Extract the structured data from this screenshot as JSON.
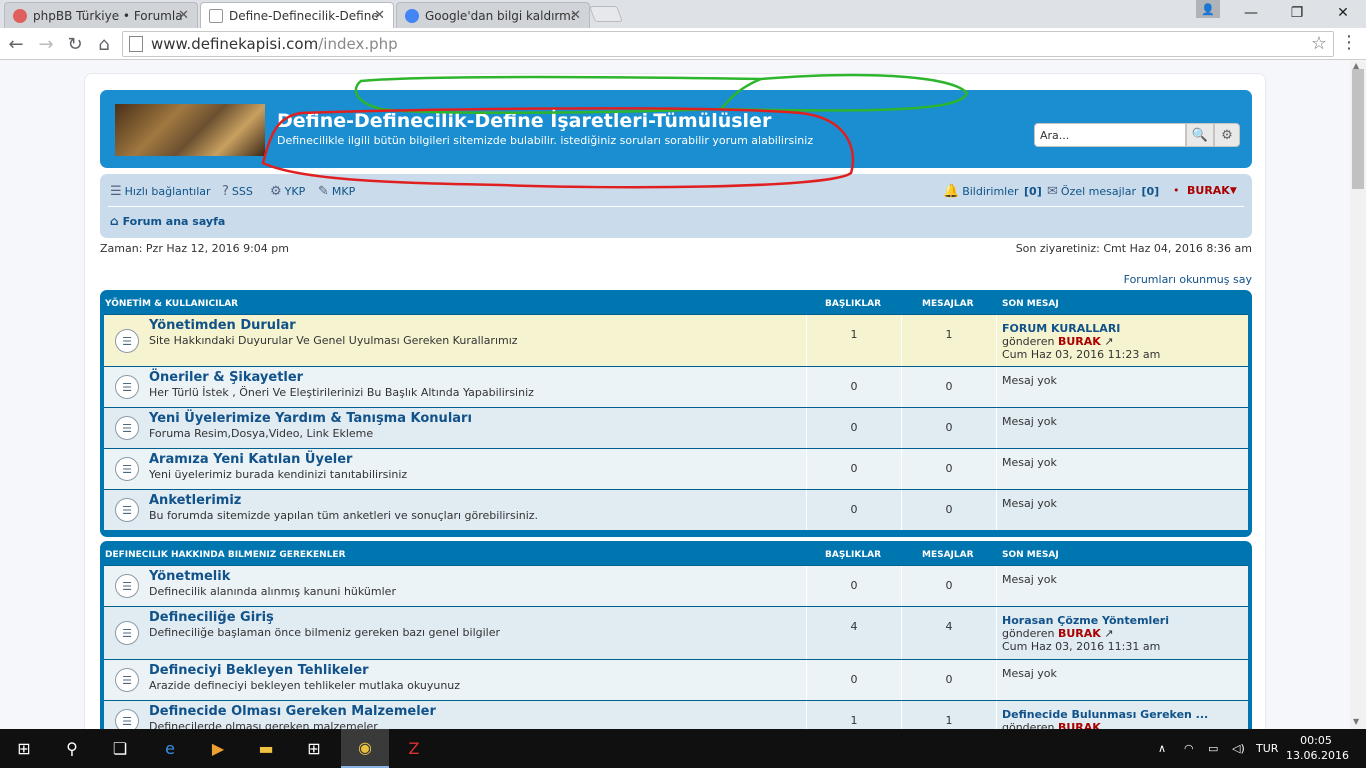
{
  "browser": {
    "tabs": [
      {
        "label": "phpBB Türkiye • Forumlar",
        "active": false
      },
      {
        "label": "Define-Definecilik-Define",
        "active": true
      },
      {
        "label": "Google'dan bilgi kaldırma",
        "active": false
      }
    ],
    "url_host": "www.definekapisi.com",
    "url_path": "/index.php"
  },
  "site": {
    "title": "Define-Definecilik-Define İşaretleri-Tümülüsler",
    "description": "Definecilikle ilgili bütün bilgileri sitemizde bulabilir. istediğiniz soruları sorabilir yorum alabilirsiniz",
    "search_placeholder": "Ara..."
  },
  "navbar": {
    "quick_links": "Hızlı bağlantılar",
    "faq": "SSS",
    "ykp": "YKP",
    "mkp": "MKP",
    "notifications": "Bildirimler",
    "notifications_count": "[0]",
    "private_messages": "Özel mesajlar",
    "pm_count": "[0]",
    "separator": "•",
    "username": "BURAK",
    "breadcrumb": "Forum ana sayfa"
  },
  "info": {
    "current_time": "Zaman: Pzr Haz 12, 2016 9:04 pm",
    "last_visit": "Son ziyaretiniz: Cmt Haz 04, 2016 8:36 am",
    "mark_read": "Forumları okunmuş say"
  },
  "categories": [
    {
      "name": "YÖNETİM & KULLANICILAR",
      "col_topics": "BAŞLIKLAR",
      "col_posts": "MESAJLAR",
      "col_last": "SON MESAJ",
      "forums": [
        {
          "title": "Yönetimden Durular",
          "desc": "Site Hakkındaki Duyurular Ve Genel Uyulması Gereken Kurallarımız",
          "topics": "1",
          "posts": "1",
          "last_title": "FORUM KURALLARI",
          "last_by": "gönderen",
          "last_author": "BURAK",
          "last_date": "Cum Haz 03, 2016 11:23 am"
        },
        {
          "title": "Öneriler & Şikayetler",
          "desc": "Her Türlü İstek , Öneri Ve Eleştirilerinizi Bu Başlık Altında Yapabilirsiniz",
          "topics": "0",
          "posts": "0",
          "no_post": "Mesaj yok"
        },
        {
          "title": "Yeni Üyelerimize Yardım & Tanışma Konuları",
          "desc": "Foruma Resim,Dosya,Video, Link Ekleme",
          "topics": "0",
          "posts": "0",
          "no_post": "Mesaj yok"
        },
        {
          "title": "Aramıza Yeni Katılan Üyeler",
          "desc": "Yeni üyelerimiz burada kendinizi tanıtabilirsiniz",
          "topics": "0",
          "posts": "0",
          "no_post": "Mesaj yok"
        },
        {
          "title": "Anketlerimiz",
          "desc": "Bu forumda sitemizde yapılan tüm anketleri ve sonuçları görebilirsiniz.",
          "topics": "0",
          "posts": "0",
          "no_post": "Mesaj yok"
        }
      ]
    },
    {
      "name": "DEFINECILIK HAKKINDA BILMENIZ GEREKENLER",
      "col_topics": "BAŞLIKLAR",
      "col_posts": "MESAJLAR",
      "col_last": "SON MESAJ",
      "forums": [
        {
          "title": "Yönetmelik",
          "desc": "Definecilik alanında alınmış kanuni hükümler",
          "topics": "0",
          "posts": "0",
          "no_post": "Mesaj yok"
        },
        {
          "title": "Defineciliğe Giriş",
          "desc": "Defineciliğe başlaman önce bilmeniz gereken bazı genel bilgiler",
          "topics": "4",
          "posts": "4",
          "last_title": "Horasan Çözme Yöntemleri",
          "last_by": "gönderen",
          "last_author": "BURAK",
          "last_date": "Cum Haz 03, 2016 11:31 am"
        },
        {
          "title": "Defineciyi Bekleyen Tehlikeler",
          "desc": "Arazide defineciyi bekleyen tehlikeler mutlaka okuyunuz",
          "topics": "0",
          "posts": "0",
          "no_post": "Mesaj yok"
        },
        {
          "title": "Definecide Olması Gereken Malzemeler",
          "desc": "Definecilerde olması gereken malzemeler",
          "topics": "1",
          "posts": "1",
          "last_title": "Definecide Bulunması Gereken ...",
          "last_by": "gönderen",
          "last_author": "BURAK"
        }
      ]
    }
  ],
  "taskbar": {
    "language": "TUR",
    "time": "00:05",
    "date": "13.06.2016"
  },
  "colors": {
    "header_blue": "#1a8ed0",
    "link_blue": "#105289",
    "username_red": "#aa0000",
    "highlight_row": "#f6f4d0"
  }
}
